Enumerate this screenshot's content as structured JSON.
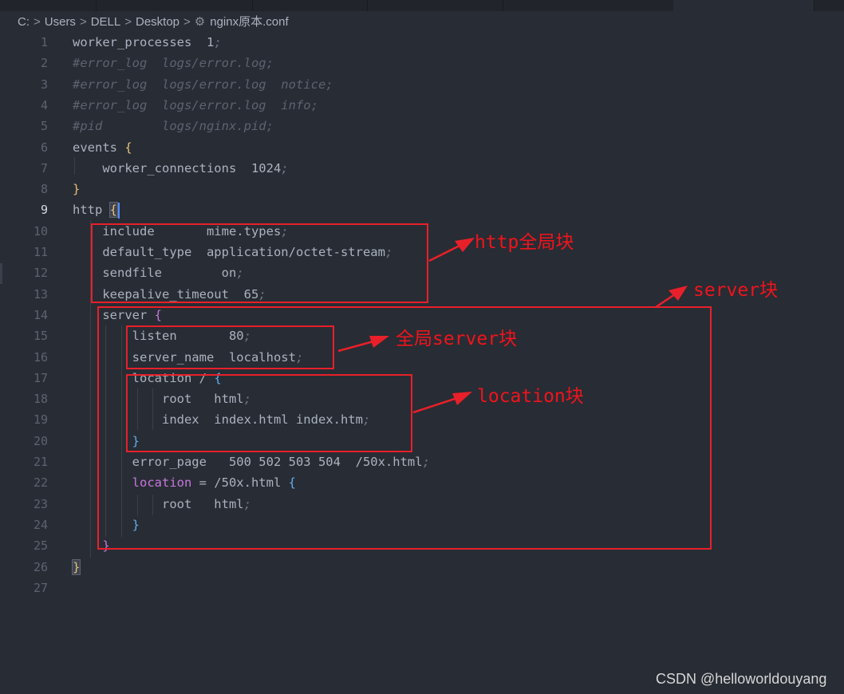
{
  "breadcrumb": {
    "items": [
      "C:",
      "Users",
      "DELL",
      "Desktop"
    ],
    "file_name": "nginx原本.conf",
    "separator": ">"
  },
  "editor": {
    "current_line": 9,
    "lines": [
      {
        "n": "1",
        "parts": [
          {
            "t": "worker_processes  1"
          },
          {
            "t": ";",
            "c": "semi"
          }
        ]
      },
      {
        "n": "2",
        "parts": [
          {
            "t": "#error_log  logs/error.log;",
            "c": "cmt"
          }
        ]
      },
      {
        "n": "3",
        "parts": [
          {
            "t": "#error_log  logs/error.log  notice;",
            "c": "cmt"
          }
        ]
      },
      {
        "n": "4",
        "parts": [
          {
            "t": "#error_log  logs/error.log  info;",
            "c": "cmt"
          }
        ]
      },
      {
        "n": "5",
        "parts": [
          {
            "t": "#pid        logs/nginx.pid;",
            "c": "cmt"
          }
        ]
      },
      {
        "n": "6",
        "parts": [
          {
            "t": "events "
          },
          {
            "t": "{",
            "c": "b-y"
          }
        ]
      },
      {
        "n": "7",
        "parts": [
          {
            "t": "    worker_connections  1024"
          },
          {
            "t": ";",
            "c": "semi"
          }
        ]
      },
      {
        "n": "8",
        "parts": [
          {
            "t": "}",
            "c": "b-y"
          }
        ]
      },
      {
        "n": "9",
        "parts": [
          {
            "t": "http "
          },
          {
            "t": "{",
            "c": "b-y bracket-hl"
          },
          {
            "t": "",
            "c": "cursor"
          }
        ]
      },
      {
        "n": "10",
        "parts": [
          {
            "t": "    include       mime.types"
          },
          {
            "t": ";",
            "c": "semi"
          }
        ]
      },
      {
        "n": "11",
        "parts": [
          {
            "t": "    default_type  application/octet-stream"
          },
          {
            "t": ";",
            "c": "semi"
          }
        ]
      },
      {
        "n": "12",
        "parts": [
          {
            "t": "    sendfile        on"
          },
          {
            "t": ";",
            "c": "semi"
          }
        ]
      },
      {
        "n": "13",
        "parts": [
          {
            "t": "    keepalive_timeout  65"
          },
          {
            "t": ";",
            "c": "semi"
          }
        ]
      },
      {
        "n": "14",
        "parts": [
          {
            "t": "    server "
          },
          {
            "t": "{",
            "c": "b-p"
          }
        ]
      },
      {
        "n": "15",
        "parts": [
          {
            "t": "        listen       80"
          },
          {
            "t": ";",
            "c": "semi"
          }
        ]
      },
      {
        "n": "16",
        "parts": [
          {
            "t": "        server_name  localhost"
          },
          {
            "t": ";",
            "c": "semi"
          }
        ]
      },
      {
        "n": "17",
        "parts": [
          {
            "t": "        location / "
          },
          {
            "t": "{",
            "c": "b-b"
          }
        ]
      },
      {
        "n": "18",
        "parts": [
          {
            "t": "            root   html"
          },
          {
            "t": ";",
            "c": "semi"
          }
        ]
      },
      {
        "n": "19",
        "parts": [
          {
            "t": "            index  index.html index.htm"
          },
          {
            "t": ";",
            "c": "semi"
          }
        ]
      },
      {
        "n": "20",
        "parts": [
          {
            "t": "        "
          },
          {
            "t": "}",
            "c": "b-b"
          }
        ]
      },
      {
        "n": "21",
        "parts": [
          {
            "t": "        error_page   500 502 503 504  /50x.html"
          },
          {
            "t": ";",
            "c": "semi"
          }
        ]
      },
      {
        "n": "22",
        "parts": [
          {
            "t": "        "
          },
          {
            "t": "location",
            "c": "kw"
          },
          {
            "t": " = /50x.html "
          },
          {
            "t": "{",
            "c": "b-b"
          }
        ]
      },
      {
        "n": "23",
        "parts": [
          {
            "t": "            root   html"
          },
          {
            "t": ";",
            "c": "semi"
          }
        ]
      },
      {
        "n": "24",
        "parts": [
          {
            "t": "        "
          },
          {
            "t": "}",
            "c": "b-b"
          }
        ]
      },
      {
        "n": "25",
        "parts": [
          {
            "t": "    "
          },
          {
            "t": "}",
            "c": "b-p"
          }
        ]
      },
      {
        "n": "26",
        "parts": [
          {
            "t": "}",
            "c": "b-y bracket-hl"
          }
        ]
      },
      {
        "n": "27",
        "parts": []
      }
    ]
  },
  "annotations": {
    "http_block": "http全局块",
    "server_block": "server块",
    "global_server_block": "全局server块",
    "location_block": "location块",
    "color": "#e8202a"
  },
  "watermark": "CSDN @helloworldouyang",
  "theme": {
    "background": "#282c34",
    "text": "#abb2bf",
    "comment": "#5c6370",
    "bracket_yellow": "#e5c07b",
    "bracket_purple": "#c678dd",
    "bracket_blue": "#61afef"
  }
}
